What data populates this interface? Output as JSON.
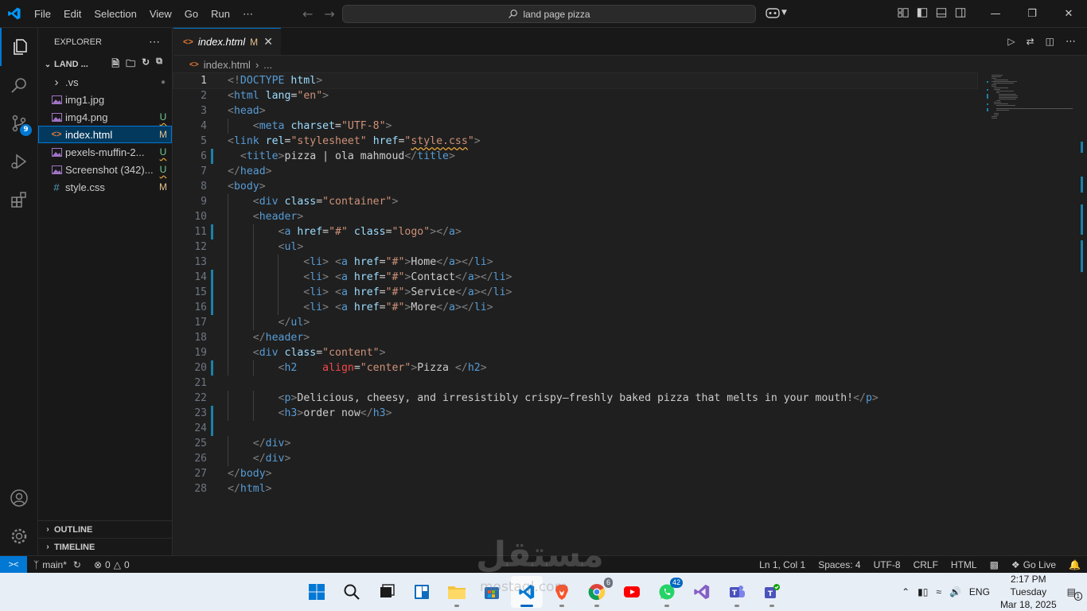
{
  "titlebar": {
    "menu": [
      "File",
      "Edit",
      "Selection",
      "View",
      "Go",
      "Run",
      "⋯"
    ],
    "search_text": "land page pizza"
  },
  "activitybar": {
    "scm_badge": "9"
  },
  "sidebar": {
    "title": "EXPLORER",
    "folder": "LAND ...",
    "files": [
      {
        "name": ".vs",
        "icon": "chevron-right",
        "status": "●",
        "kind": "folder"
      },
      {
        "name": "img1.jpg",
        "icon": "image",
        "status": "",
        "kind": "image"
      },
      {
        "name": "img4.png",
        "icon": "image",
        "status": "U",
        "kind": "image"
      },
      {
        "name": "index.html",
        "icon": "html",
        "status": "M",
        "kind": "html"
      },
      {
        "name": "pexels-muffin-2...",
        "icon": "image",
        "status": "U",
        "kind": "image"
      },
      {
        "name": "Screenshot (342)...",
        "icon": "image",
        "status": "U",
        "kind": "image"
      },
      {
        "name": "style.css",
        "icon": "css",
        "status": "M",
        "kind": "css"
      }
    ],
    "outline": "OUTLINE",
    "timeline": "TIMELINE"
  },
  "editor": {
    "tab": {
      "name": "index.html",
      "mod": "M"
    },
    "breadcrumb": {
      "file": "index.html",
      "more": "..."
    },
    "lines": [
      {
        "n": "1",
        "mod": false,
        "indent": 0,
        "parts": [
          [
            "t",
            "<!"
          ],
          [
            "tag",
            "DOCTYPE"
          ],
          [
            "txt",
            " "
          ],
          [
            "attr",
            "html"
          ],
          [
            "t",
            ">"
          ]
        ]
      },
      {
        "n": "2",
        "mod": false,
        "indent": 0,
        "parts": [
          [
            "t",
            "<"
          ],
          [
            "tag",
            "html"
          ],
          [
            "txt",
            " "
          ],
          [
            "attr",
            "lang"
          ],
          [
            "txt",
            "="
          ],
          [
            "str",
            "\"en\""
          ],
          [
            "t",
            ">"
          ]
        ]
      },
      {
        "n": "3",
        "mod": false,
        "indent": 0,
        "parts": [
          [
            "t",
            "<"
          ],
          [
            "tag",
            "head"
          ],
          [
            "t",
            ">"
          ]
        ]
      },
      {
        "n": "4",
        "mod": false,
        "indent": 1,
        "parts": [
          [
            "t",
            "<"
          ],
          [
            "tag",
            "meta"
          ],
          [
            "txt",
            " "
          ],
          [
            "attr",
            "charset"
          ],
          [
            "txt",
            "="
          ],
          [
            "str",
            "\"UTF-8\""
          ],
          [
            "t",
            ">"
          ]
        ]
      },
      {
        "n": "5",
        "mod": false,
        "indent": 0,
        "parts": [
          [
            "t",
            "<"
          ],
          [
            "tag",
            "link"
          ],
          [
            "txt",
            " "
          ],
          [
            "attr",
            "rel"
          ],
          [
            "txt",
            "="
          ],
          [
            "str",
            "\"stylesheet\""
          ],
          [
            "txt",
            " "
          ],
          [
            "attr",
            "href"
          ],
          [
            "txt",
            "="
          ],
          [
            "str",
            "\""
          ],
          [
            "stru",
            "style.css"
          ],
          [
            "str",
            "\""
          ],
          [
            "t",
            ">"
          ]
        ]
      },
      {
        "n": "6",
        "mod": true,
        "indent": 0,
        "parts": [
          [
            "txt",
            "  "
          ],
          [
            "t",
            "<"
          ],
          [
            "tag",
            "title"
          ],
          [
            "t",
            ">"
          ],
          [
            "txt",
            "pizza | ola mahmoud"
          ],
          [
            "t",
            "</"
          ],
          [
            "tag",
            "title"
          ],
          [
            "t",
            ">"
          ]
        ]
      },
      {
        "n": "7",
        "mod": false,
        "indent": 0,
        "parts": [
          [
            "t",
            "</"
          ],
          [
            "tag",
            "head"
          ],
          [
            "t",
            ">"
          ]
        ]
      },
      {
        "n": "8",
        "mod": false,
        "indent": 0,
        "parts": [
          [
            "t",
            "<"
          ],
          [
            "tag",
            "body"
          ],
          [
            "t",
            ">"
          ]
        ]
      },
      {
        "n": "9",
        "mod": false,
        "indent": 1,
        "parts": [
          [
            "t",
            "<"
          ],
          [
            "tag",
            "div"
          ],
          [
            "txt",
            " "
          ],
          [
            "attr",
            "class"
          ],
          [
            "txt",
            "="
          ],
          [
            "str",
            "\"container\""
          ],
          [
            "t",
            ">"
          ]
        ]
      },
      {
        "n": "10",
        "mod": false,
        "indent": 1,
        "parts": [
          [
            "t",
            "<"
          ],
          [
            "tag",
            "header"
          ],
          [
            "t",
            ">"
          ]
        ]
      },
      {
        "n": "11",
        "mod": true,
        "indent": 2,
        "parts": [
          [
            "t",
            "<"
          ],
          [
            "tag",
            "a"
          ],
          [
            "txt",
            " "
          ],
          [
            "attr",
            "href"
          ],
          [
            "txt",
            "="
          ],
          [
            "str",
            "\"#\""
          ],
          [
            "txt",
            " "
          ],
          [
            "attr",
            "class"
          ],
          [
            "txt",
            "="
          ],
          [
            "str",
            "\"logo\""
          ],
          [
            "t",
            "></"
          ],
          [
            "tag",
            "a"
          ],
          [
            "t",
            ">"
          ]
        ]
      },
      {
        "n": "12",
        "mod": false,
        "indent": 2,
        "parts": [
          [
            "t",
            "<"
          ],
          [
            "tag",
            "ul"
          ],
          [
            "t",
            ">"
          ]
        ]
      },
      {
        "n": "13",
        "mod": false,
        "indent": 3,
        "parts": [
          [
            "t",
            "<"
          ],
          [
            "tag",
            "li"
          ],
          [
            "t",
            ">"
          ],
          [
            "txt",
            " "
          ],
          [
            "t",
            "<"
          ],
          [
            "tag",
            "a"
          ],
          [
            "txt",
            " "
          ],
          [
            "attr",
            "href"
          ],
          [
            "txt",
            "="
          ],
          [
            "str",
            "\"#\""
          ],
          [
            "t",
            ">"
          ],
          [
            "txt",
            "Home"
          ],
          [
            "t",
            "</"
          ],
          [
            "tag",
            "a"
          ],
          [
            "t",
            "></"
          ],
          [
            "tag",
            "li"
          ],
          [
            "t",
            ">"
          ]
        ]
      },
      {
        "n": "14",
        "mod": true,
        "indent": 3,
        "parts": [
          [
            "t",
            "<"
          ],
          [
            "tag",
            "li"
          ],
          [
            "t",
            ">"
          ],
          [
            "txt",
            " "
          ],
          [
            "t",
            "<"
          ],
          [
            "tag",
            "a"
          ],
          [
            "txt",
            " "
          ],
          [
            "attr",
            "href"
          ],
          [
            "txt",
            "="
          ],
          [
            "str",
            "\"#\""
          ],
          [
            "t",
            ">"
          ],
          [
            "txt",
            "Contact"
          ],
          [
            "t",
            "</"
          ],
          [
            "tag",
            "a"
          ],
          [
            "t",
            "></"
          ],
          [
            "tag",
            "li"
          ],
          [
            "t",
            ">"
          ]
        ]
      },
      {
        "n": "15",
        "mod": true,
        "indent": 3,
        "parts": [
          [
            "t",
            "<"
          ],
          [
            "tag",
            "li"
          ],
          [
            "t",
            ">"
          ],
          [
            "txt",
            " "
          ],
          [
            "t",
            "<"
          ],
          [
            "tag",
            "a"
          ],
          [
            "txt",
            " "
          ],
          [
            "attr",
            "href"
          ],
          [
            "txt",
            "="
          ],
          [
            "str",
            "\"#\""
          ],
          [
            "t",
            ">"
          ],
          [
            "txt",
            "Service"
          ],
          [
            "t",
            "</"
          ],
          [
            "tag",
            "a"
          ],
          [
            "t",
            "></"
          ],
          [
            "tag",
            "li"
          ],
          [
            "t",
            ">"
          ]
        ]
      },
      {
        "n": "16",
        "mod": true,
        "indent": 3,
        "parts": [
          [
            "t",
            "<"
          ],
          [
            "tag",
            "li"
          ],
          [
            "t",
            ">"
          ],
          [
            "txt",
            " "
          ],
          [
            "t",
            "<"
          ],
          [
            "tag",
            "a"
          ],
          [
            "txt",
            " "
          ],
          [
            "attr",
            "href"
          ],
          [
            "txt",
            "="
          ],
          [
            "str",
            "\"#\""
          ],
          [
            "t",
            ">"
          ],
          [
            "txt",
            "More"
          ],
          [
            "t",
            "</"
          ],
          [
            "tag",
            "a"
          ],
          [
            "t",
            "></"
          ],
          [
            "tag",
            "li"
          ],
          [
            "t",
            ">"
          ]
        ]
      },
      {
        "n": "17",
        "mod": false,
        "indent": 2,
        "parts": [
          [
            "t",
            "</"
          ],
          [
            "tag",
            "ul"
          ],
          [
            "t",
            ">"
          ]
        ]
      },
      {
        "n": "18",
        "mod": false,
        "indent": 1,
        "parts": [
          [
            "t",
            "</"
          ],
          [
            "tag",
            "header"
          ],
          [
            "t",
            ">"
          ]
        ]
      },
      {
        "n": "19",
        "mod": false,
        "indent": 1,
        "parts": [
          [
            "t",
            "<"
          ],
          [
            "tag",
            "div"
          ],
          [
            "txt",
            " "
          ],
          [
            "attr",
            "class"
          ],
          [
            "txt",
            "="
          ],
          [
            "str",
            "\"content\""
          ],
          [
            "t",
            ">"
          ]
        ]
      },
      {
        "n": "20",
        "mod": true,
        "indent": 2,
        "parts": [
          [
            "t",
            "<"
          ],
          [
            "tag",
            "h2"
          ],
          [
            "txt",
            "    "
          ],
          [
            "err",
            "align"
          ],
          [
            "txt",
            "="
          ],
          [
            "str",
            "\"center\""
          ],
          [
            "t",
            ">"
          ],
          [
            "txt",
            "Pizza "
          ],
          [
            "t",
            "</"
          ],
          [
            "tag",
            "h2"
          ],
          [
            "t",
            ">"
          ]
        ]
      },
      {
        "n": "21",
        "mod": false,
        "indent": 0,
        "parts": []
      },
      {
        "n": "22",
        "mod": false,
        "indent": 2,
        "parts": [
          [
            "t",
            "<"
          ],
          [
            "tag",
            "p"
          ],
          [
            "t",
            ">"
          ],
          [
            "txt",
            "Delicious, cheesy, and irresistibly crispy—freshly baked pizza that melts in your mouth!"
          ],
          [
            "t",
            "</"
          ],
          [
            "tag",
            "p"
          ],
          [
            "t",
            ">"
          ]
        ]
      },
      {
        "n": "23",
        "mod": true,
        "indent": 2,
        "parts": [
          [
            "t",
            "<"
          ],
          [
            "tag",
            "h3"
          ],
          [
            "t",
            ">"
          ],
          [
            "txt",
            "order now"
          ],
          [
            "t",
            "</"
          ],
          [
            "tag",
            "h3"
          ],
          [
            "t",
            ">"
          ]
        ]
      },
      {
        "n": "24",
        "mod": true,
        "indent": 0,
        "parts": []
      },
      {
        "n": "25",
        "mod": false,
        "indent": 1,
        "parts": [
          [
            "t",
            "</"
          ],
          [
            "tag",
            "div"
          ],
          [
            "t",
            ">"
          ]
        ]
      },
      {
        "n": "26",
        "mod": false,
        "indent": 1,
        "parts": [
          [
            "t",
            "</"
          ],
          [
            "tag",
            "div"
          ],
          [
            "t",
            ">"
          ]
        ]
      },
      {
        "n": "27",
        "mod": false,
        "indent": 0,
        "parts": [
          [
            "t",
            "</"
          ],
          [
            "tag",
            "body"
          ],
          [
            "t",
            ">"
          ]
        ]
      },
      {
        "n": "28",
        "mod": false,
        "indent": 0,
        "parts": [
          [
            "t",
            "</"
          ],
          [
            "tag",
            "html"
          ],
          [
            "t",
            ">"
          ]
        ]
      }
    ]
  },
  "statusbar": {
    "branch": "main*",
    "errors": "0",
    "warnings": "0",
    "position": "Ln 1, Col 1",
    "spaces": "Spaces: 4",
    "encoding": "UTF-8",
    "eol": "CRLF",
    "language": "HTML",
    "golive": "Go Live",
    "notifications": "1"
  },
  "taskbar": {
    "chrome_badge": "6",
    "whatsapp_badge": "42",
    "lang": "ENG",
    "time": "2:17 PM",
    "day": "Tuesday",
    "date": "Mar 18, 2025"
  },
  "watermark": {
    "arabic": "مستقل",
    "latin": "mostaql.com"
  },
  "colors": {
    "accent": "#0078d4",
    "modified": "#e2c08d",
    "untracked": "#73c991",
    "tag": "#569cd6",
    "attr": "#9cdcfe",
    "string": "#ce9178"
  }
}
